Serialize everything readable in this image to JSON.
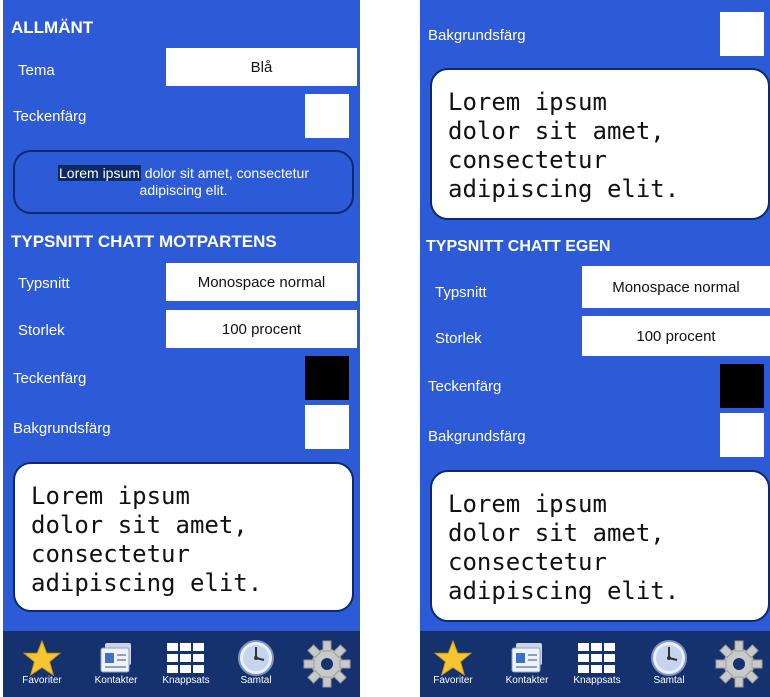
{
  "left": {
    "general": {
      "title": "ALLMÄNT",
      "theme_label": "Tema",
      "theme_value": "Blå",
      "text_color_label": "Teckenfärg",
      "preview_selected": "Lorem ipsum",
      "preview_rest": " dolor sit amet, consectetur adipiscing elit."
    },
    "chat_other": {
      "title": "TYPSNITT CHATT MOTPARTENS",
      "font_label": "Typsnitt",
      "font_value": "Monospace normal",
      "size_label": "Storlek",
      "size_value": "100 procent",
      "text_color_label": "Teckenfärg",
      "bg_color_label": "Bakgrundsfärg",
      "preview": "Lorem ipsum\ndolor sit amet,\nconsectetur\nadipiscing elit."
    }
  },
  "right": {
    "top": {
      "bg_color_label": "Bakgrundsfärg",
      "preview": "Lorem ipsum\ndolor sit amet,\nconsectetur\nadipiscing elit."
    },
    "chat_own": {
      "title": "TYPSNITT CHATT EGEN",
      "font_label": "Typsnitt",
      "font_value": "Monospace normal",
      "size_label": "Storlek",
      "size_value": "100 procent",
      "text_color_label": "Teckenfärg",
      "bg_color_label": "Bakgrundsfärg",
      "preview": "Lorem ipsum\ndolor sit amet,\nconsectetur\nadipiscing elit."
    }
  },
  "nav": {
    "favorites": "Favoriter",
    "contacts": "Kontakter",
    "keypad": "Knappsats",
    "calls": "Samtal"
  },
  "icons": {
    "favorites": "star-icon",
    "contacts": "contact-card-icon",
    "keypad": "keypad-grid-icon",
    "calls": "clock-icon",
    "settings": "gear-icon"
  },
  "colors": {
    "background": "#2d5ad6",
    "nav_background": "#15326f",
    "swatch_white": "#ffffff",
    "swatch_black": "#000000",
    "star": "#f7c531"
  }
}
